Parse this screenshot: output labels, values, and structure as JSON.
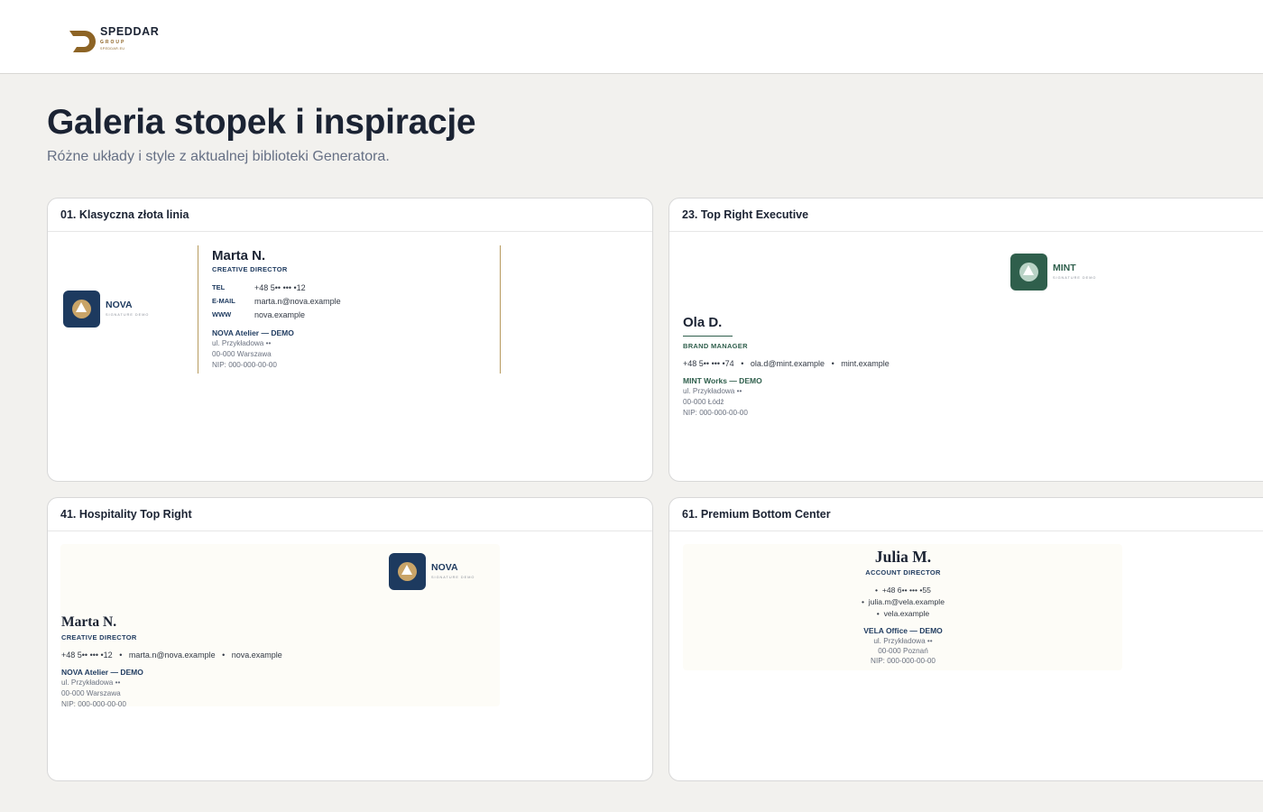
{
  "brand": {
    "name": "SPEDDAR",
    "group": "GROUP",
    "url": "SPEDDAR.EU",
    "color": "#8d6425"
  },
  "page": {
    "title": "Galeria stopek i inspiracje",
    "subtitle": "Różne układy i style z aktualnej biblioteki Generatora."
  },
  "cards": [
    {
      "title": "01. Klasyczna złota linia",
      "logo": {
        "word": "NOVA",
        "tag": "SIGNATURE DEMO",
        "icon": "mountain-logo-icon",
        "tile_color": "#1d3a5f",
        "circle_color": "#c9a468"
      },
      "name": "Marta N.",
      "role": "CREATIVE DIRECTOR",
      "contacts": [
        {
          "label": "TEL",
          "value": "+48 5•• ••• •12"
        },
        {
          "label": "E-MAIL",
          "value": "marta.n@nova.example"
        },
        {
          "label": "WWW",
          "value": "nova.example"
        }
      ],
      "company": "NOVA Atelier — DEMO",
      "address": [
        "ul. Przykładowa ••",
        "00-000 Warszawa",
        "NIP: 000-000-00-00"
      ],
      "accent": "#1e3a5f",
      "line_color": "#b79b5f"
    },
    {
      "title": "23. Top Right Executive",
      "logo": {
        "word": "MINT",
        "tag": "SIGNATURE DEMO",
        "icon": "mountain-logo-icon",
        "tile_color": "#2f5f4c",
        "circle_color": "#b9d3c6"
      },
      "name": "Ola D.",
      "role": "BRAND MANAGER",
      "contact_line": [
        "+48 5•• ••• •74",
        "ola.d@mint.example",
        "mint.example"
      ],
      "separator": "•",
      "company": "MINT Works — DEMO",
      "address": [
        "ul. Przykładowa ••",
        "00-000 Łódź",
        "NIP: 000-000-00-00"
      ],
      "accent": "#2f5f4c"
    },
    {
      "title": "41. Hospitality Top Right",
      "logo": {
        "word": "NOVA",
        "tag": "SIGNATURE DEMO",
        "icon": "mountain-logo-icon",
        "tile_color": "#1d3a5f",
        "circle_color": "#c9a468"
      },
      "name": "Marta N.",
      "role": "CREATIVE DIRECTOR",
      "contact_line": [
        "+48 5•• ••• •12",
        "marta.n@nova.example",
        "nova.example"
      ],
      "separator": "•",
      "company": "NOVA Atelier — DEMO",
      "address": [
        "ul. Przykładowa ••",
        "00-000 Warszawa",
        "NIP: 000-000-00-00"
      ],
      "accent": "#1e3a5f"
    },
    {
      "title": "61. Premium Bottom Center",
      "name": "Julia M.",
      "role": "ACCOUNT DIRECTOR",
      "contacts": [
        "+48 6•• ••• •55",
        "julia.m@vela.example",
        "vela.example"
      ],
      "bullet": "•",
      "company": "VELA Office — DEMO",
      "address": [
        "ul. Przykładowa ••",
        "00-000 Poznań",
        "NIP: 000-000-00-00"
      ],
      "accent": "#1e3a5f"
    }
  ]
}
